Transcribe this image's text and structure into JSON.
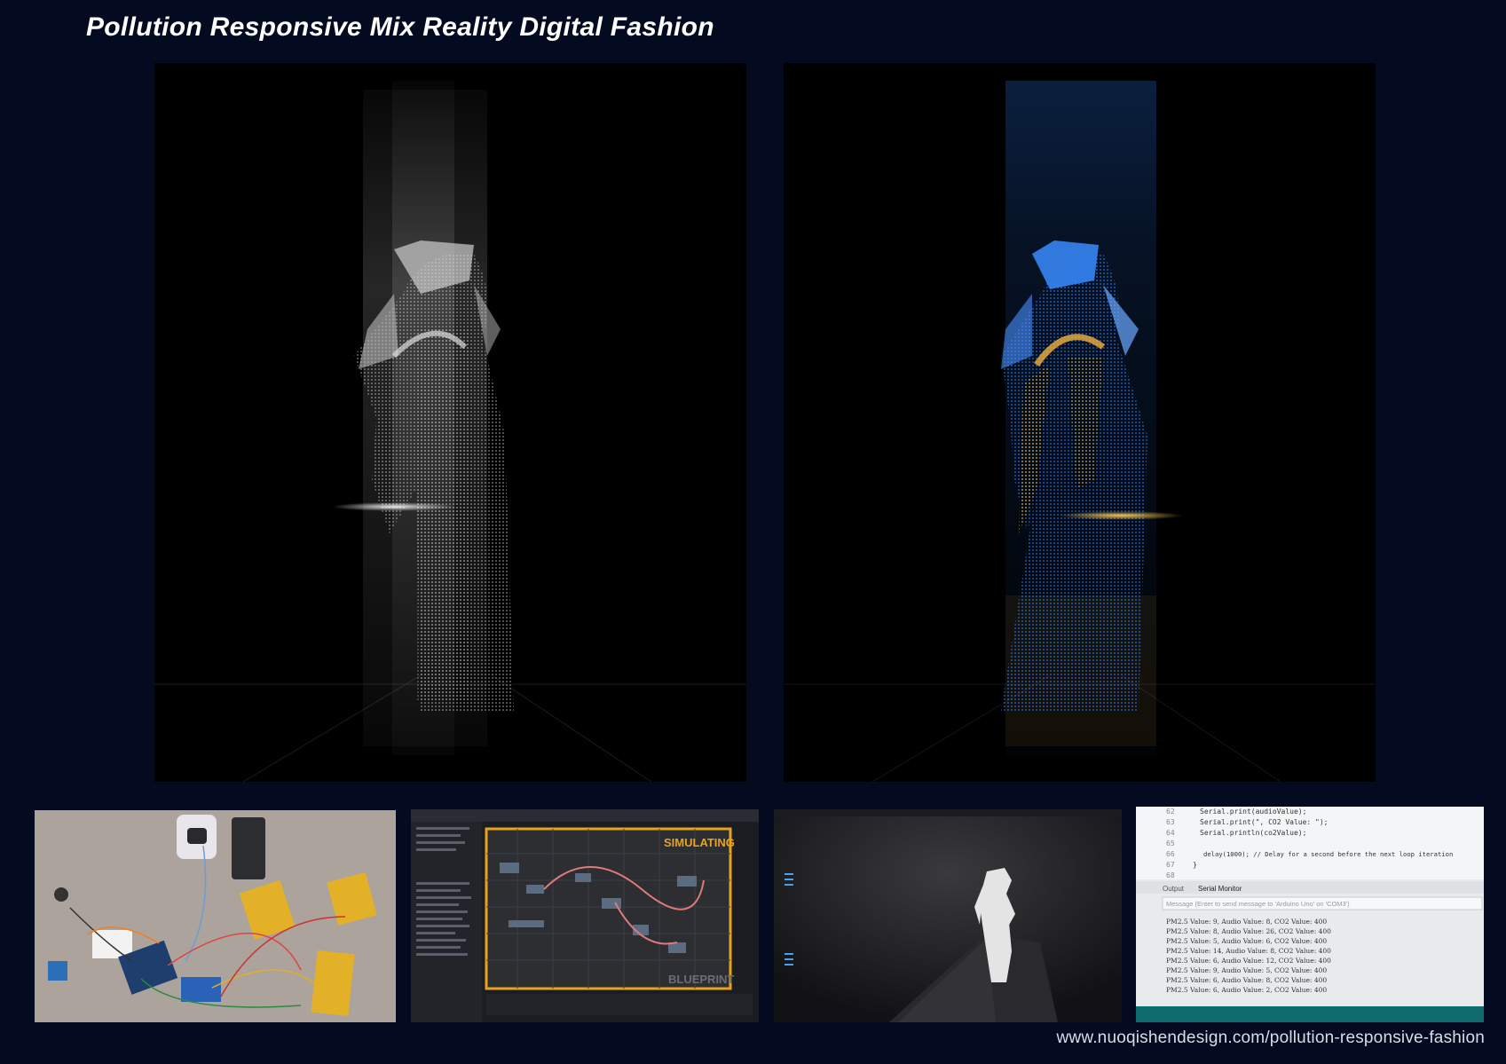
{
  "page": {
    "title": "Pollution Responsive Mix Reality Digital Fashion",
    "footer_url": "www.nuoqishendesign.com/pollution-responsive-fashion"
  },
  "colors": {
    "background": "#040a1f",
    "hologram_white": "#d8d8d8",
    "hologram_blue": "#2a7fff",
    "hologram_amber": "#f0a820",
    "heater_pad": "#e2b128"
  },
  "thumbnails": {
    "blueprint": {
      "simulating_label": "SIMULATING",
      "blueprint_label": "BLUEPRINT"
    },
    "serial_code": {
      "lines": [
        {
          "num": "62",
          "text": "Serial.print(audioValue);"
        },
        {
          "num": "63",
          "text": "Serial.print(\", CO2 Value: \");"
        },
        {
          "num": "64",
          "text": "Serial.println(co2Value);"
        },
        {
          "num": "65",
          "text": ""
        },
        {
          "num": "66",
          "text": "delay(1000); // Delay for a second before the next loop iteration"
        },
        {
          "num": "67",
          "text": "}"
        },
        {
          "num": "68",
          "text": ""
        }
      ],
      "tab_output": "Output",
      "tab_serial_monitor": "Serial Monitor",
      "message_placeholder": "Message (Enter to send message to 'Arduino Uno' on 'COM3')",
      "monitor_rows": [
        "PM2.5 Value: 9, Audio Value: 8, CO2 Value: 400",
        "PM2.5 Value: 8, Audio Value: 26, CO2 Value: 400",
        "PM2.5 Value: 5, Audio Value: 6, CO2 Value: 400",
        "PM2.5 Value: 14, Audio Value: 8, CO2 Value: 400",
        "PM2.5 Value: 6, Audio Value: 12, CO2 Value: 400",
        "PM2.5 Value: 9, Audio Value: 5, CO2 Value: 400",
        "PM2.5 Value: 6, Audio Value: 8, CO2 Value: 400",
        "PM2.5 Value: 6, Audio Value: 2, CO2 Value: 400"
      ]
    }
  }
}
